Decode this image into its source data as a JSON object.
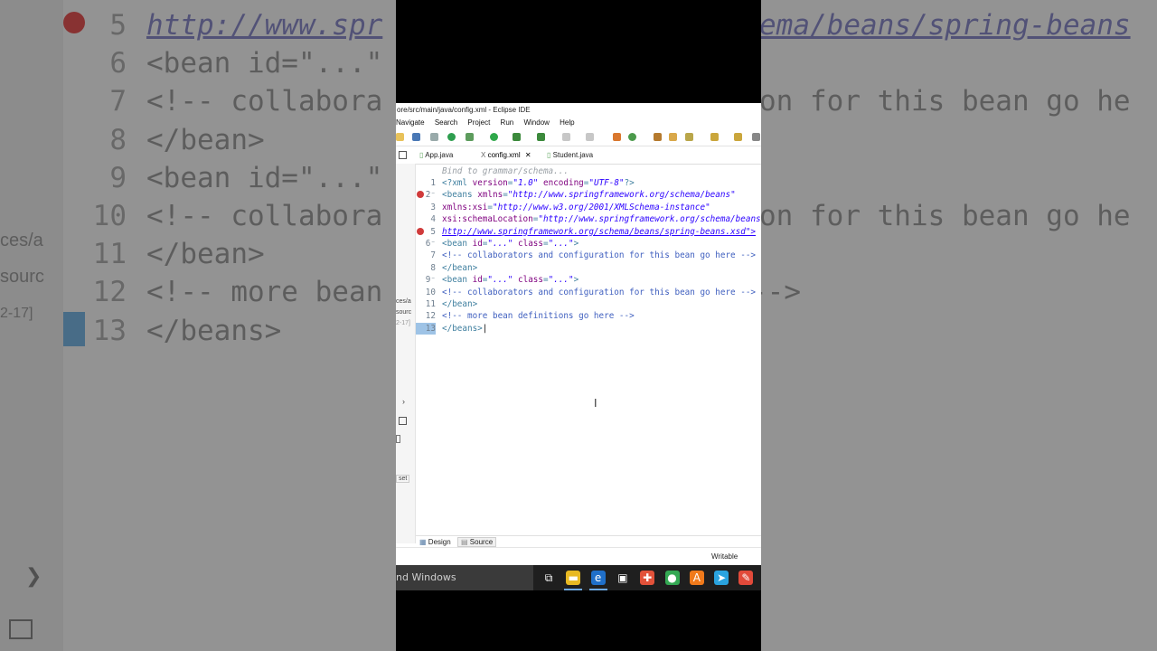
{
  "background": {
    "lines": [
      {
        "num": "5",
        "text": "http://www.spr",
        "text2": "ema/beans/spring-beans",
        "kind": "link"
      },
      {
        "num": "6",
        "text": "<bean id=\"...\"",
        "text2": "",
        "kind": "tag"
      },
      {
        "num": "7",
        "text": "<!-- collabora",
        "text2": "on for this bean go he",
        "kind": "plain"
      },
      {
        "num": "8",
        "text": "</bean>",
        "text2": "",
        "kind": "tag"
      },
      {
        "num": "9",
        "text": "<bean id=\"...\"",
        "text2": "",
        "kind": "tag"
      },
      {
        "num": "10",
        "text": "<!-- collabora",
        "text2": "on for this bean go he",
        "kind": "plain"
      },
      {
        "num": "11",
        "text": "</bean>",
        "text2": "",
        "kind": "tag"
      },
      {
        "num": "12",
        "text": "<!-- more bean",
        "text2": "-->",
        "kind": "plain"
      },
      {
        "num": "13",
        "text": "</beans>",
        "text2": "",
        "kind": "tag"
      }
    ],
    "side_texts": [
      "ces/a",
      "sourc",
      "2-17]"
    ]
  },
  "ide": {
    "title": "ore/src/main/java/config.xml - Eclipse IDE",
    "menu": [
      "Navigate",
      "Search",
      "Project",
      "Run",
      "Window",
      "Help"
    ],
    "tabs": [
      {
        "label": "App.java",
        "icon": "java-file-icon"
      },
      {
        "label": "config.xml",
        "icon": "xml-file-icon",
        "active": true,
        "close": "✕"
      },
      {
        "label": "Student.java",
        "icon": "java-file-icon"
      }
    ],
    "side_strip_texts": [
      "ces/a",
      "sourc",
      "2-17]",
      "set"
    ],
    "editor": {
      "hint": "Bind to grammar/schema...",
      "lines": [
        {
          "num": "1",
          "parts": [
            [
              "tag",
              "<?xml "
            ],
            [
              "attr",
              "version"
            ],
            [
              "tag",
              "="
            ],
            [
              "str",
              "\"1.0\""
            ],
            [
              "tag",
              " "
            ],
            [
              "attr",
              "encoding"
            ],
            [
              "tag",
              "="
            ],
            [
              "str",
              "\"UTF-8\""
            ],
            [
              "tag",
              "?>"
            ]
          ]
        },
        {
          "num": "2",
          "fold": true,
          "error": true,
          "parts": [
            [
              "tag",
              "<beans "
            ],
            [
              "attr",
              "xmlns"
            ],
            [
              "tag",
              "="
            ],
            [
              "str",
              "\"http://www.springframework.org/schema/beans\""
            ]
          ]
        },
        {
          "num": "3",
          "parts": [
            [
              "attr",
              "xmlns:xsi"
            ],
            [
              "tag",
              "="
            ],
            [
              "str",
              "\"http://www.w3.org/2001/XMLSchema-instance\""
            ]
          ]
        },
        {
          "num": "4",
          "parts": [
            [
              "attr",
              "xsi:schemaLocation"
            ],
            [
              "tag",
              "="
            ],
            [
              "str",
              "\"http://www.springframework.org/schema/beans\""
            ]
          ]
        },
        {
          "num": "5",
          "error": true,
          "parts": [
            [
              "str",
              "http://www.springframework.org/schema/beans/spring-beans.xsd\">"
            ]
          ]
        },
        {
          "num": "6",
          "fold": true,
          "parts": [
            [
              "tag",
              "<bean "
            ],
            [
              "attr",
              "id"
            ],
            [
              "tag",
              "="
            ],
            [
              "str",
              "\"...\""
            ],
            [
              "tag",
              " "
            ],
            [
              "attr",
              "class"
            ],
            [
              "tag",
              "="
            ],
            [
              "str",
              "\"...\""
            ],
            [
              "tag",
              ">"
            ]
          ]
        },
        {
          "num": "7",
          "parts": [
            [
              "comment",
              "<!-- collaborators and configuration for this bean go here -->"
            ]
          ]
        },
        {
          "num": "8",
          "parts": [
            [
              "tag",
              "</bean>"
            ]
          ]
        },
        {
          "num": "9",
          "fold": true,
          "parts": [
            [
              "tag",
              "<bean "
            ],
            [
              "attr",
              "id"
            ],
            [
              "tag",
              "="
            ],
            [
              "str",
              "\"...\""
            ],
            [
              "tag",
              " "
            ],
            [
              "attr",
              "class"
            ],
            [
              "tag",
              "="
            ],
            [
              "str",
              "\"...\""
            ],
            [
              "tag",
              ">"
            ]
          ]
        },
        {
          "num": "10",
          "parts": [
            [
              "comment",
              "<!-- collaborators and configuration for this bean go here -->"
            ]
          ]
        },
        {
          "num": "11",
          "parts": [
            [
              "tag",
              "</bean>"
            ]
          ]
        },
        {
          "num": "12",
          "parts": [
            [
              "comment",
              "<!-- more bean definitions go here -->"
            ]
          ]
        },
        {
          "num": "13",
          "current": true,
          "parts": [
            [
              "tag",
              "</beans>"
            ]
          ]
        }
      ]
    },
    "bottom_tabs": [
      {
        "label": "Design",
        "icon": "design-icon"
      },
      {
        "label": "Source",
        "icon": "source-icon",
        "selected": true
      }
    ],
    "status": {
      "writable": "Writable"
    }
  },
  "taskbar": {
    "search_text": "nd Windows",
    "icons": [
      {
        "name": "task-view-icon",
        "glyph": "⧉",
        "color": "#1f1f1f"
      },
      {
        "name": "file-explorer-icon",
        "glyph": "▬",
        "color": "#e8b923"
      },
      {
        "name": "edge-browser-icon",
        "glyph": "e",
        "color": "#1f6fc9"
      },
      {
        "name": "store-icon",
        "glyph": "▣",
        "color": "#1f1f1f"
      },
      {
        "name": "git-app-icon",
        "glyph": "✚",
        "color": "#e2523a"
      },
      {
        "name": "chrome-icon",
        "glyph": "●",
        "color": "#34a853"
      },
      {
        "name": "avast-icon",
        "glyph": "A",
        "color": "#f07a1b"
      },
      {
        "name": "telegram-icon",
        "glyph": "➤",
        "color": "#2aa3df"
      },
      {
        "name": "paint-icon",
        "glyph": "✎",
        "color": "#e24a3a"
      }
    ]
  }
}
